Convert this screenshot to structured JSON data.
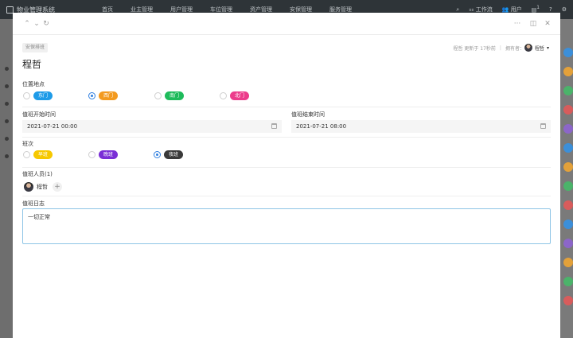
{
  "app": {
    "title": "物业管理系统",
    "nav": [
      "首页",
      "业主管理",
      "用户管理",
      "车位管理",
      "资产管理",
      "安保管理",
      "服务管理"
    ],
    "right": {
      "workspace_label": "工作流",
      "user_label": "用户",
      "badge": "1"
    }
  },
  "modal": {
    "type_tag": "安保排班",
    "title": "程哲",
    "meta": {
      "updated_text": "程哲 更新于 17秒前",
      "owner_label": "拥有者：",
      "owner_name": "程哲"
    },
    "location": {
      "label": "位置地点",
      "options": [
        {
          "label": "东门",
          "color": "#1e9be8",
          "checked": false
        },
        {
          "label": "西门",
          "color": "#f39a1f",
          "checked": true
        },
        {
          "label": "南门",
          "color": "#1ebb5b",
          "checked": false
        },
        {
          "label": "北门",
          "color": "#ec3c8b",
          "checked": false
        }
      ]
    },
    "start_time": {
      "label": "值班开始时间",
      "value": "2021-07-21 00:00"
    },
    "end_time": {
      "label": "值班结束时间",
      "value": "2021-07-21 08:00"
    },
    "shift": {
      "label": "班次",
      "options": [
        {
          "label": "早班",
          "color": "#f6c800",
          "checked": false
        },
        {
          "label": "晚班",
          "color": "#7a2fd6",
          "checked": false
        },
        {
          "label": "夜班",
          "color": "#3a3a3a",
          "checked": true
        }
      ]
    },
    "staff": {
      "label": "值班人员(1)",
      "members": [
        "程哲"
      ],
      "add_symbol": "+"
    },
    "log": {
      "label": "值班日志",
      "value": "一切正常"
    },
    "icons": {
      "prev": "chevron-up-icon",
      "next": "chevron-down-icon",
      "refresh": "refresh-icon",
      "more": "more-icon",
      "panel": "panel-icon",
      "close": "close-icon"
    }
  }
}
